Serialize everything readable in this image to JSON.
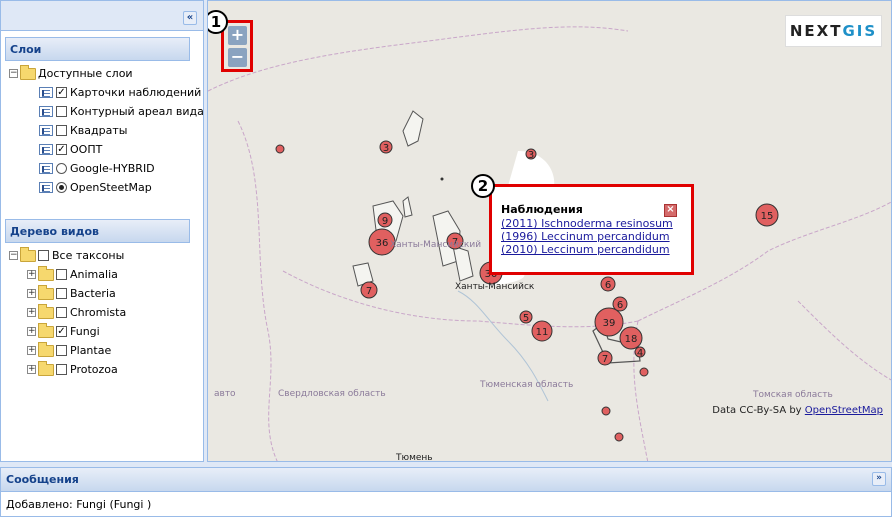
{
  "sidebar": {
    "collapse_icon": "«",
    "layers_header": "Слои",
    "layers_root": "Доступные слои",
    "layers": [
      {
        "label": "Карточки наблюдений",
        "control": "checkbox",
        "checked": true
      },
      {
        "label": "Контурный ареал вида",
        "control": "checkbox",
        "checked": false
      },
      {
        "label": "Квадраты",
        "control": "checkbox",
        "checked": false
      },
      {
        "label": "ООПТ",
        "control": "checkbox",
        "checked": true
      },
      {
        "label": "Google-HYBRID",
        "control": "radio",
        "checked": false
      },
      {
        "label": "OpenSteetMap",
        "control": "radio",
        "checked": true
      }
    ],
    "species_header": "Дерево видов",
    "species_root": "Все таксоны",
    "taxa": [
      {
        "label": "Animalia",
        "checked": false
      },
      {
        "label": "Bacteria",
        "checked": false
      },
      {
        "label": "Chromista",
        "checked": false
      },
      {
        "label": "Fungi",
        "checked": true
      },
      {
        "label": "Plantae",
        "checked": false
      },
      {
        "label": "Protozoa",
        "checked": false
      }
    ]
  },
  "map": {
    "zoom_in": "+",
    "zoom_out": "−",
    "callout_1": "1",
    "callout_2": "2",
    "logo_prefix": "NEXT",
    "logo_suffix": "GIS",
    "popup": {
      "title": "Наблюдения",
      "links": [
        "(2011) Ischnoderma resinosum",
        "(1996) Leccinum percandidum",
        "(2010) Leccinum percandidum"
      ],
      "close_icon": "close-icon"
    },
    "labels": {
      "city_khanty": "Ханты-Мансийск",
      "region_khanty": "Ханты-Мансийский",
      "region_sverdlovsk": "Свердловская область",
      "region_tyumen": "Тюменская область",
      "region_tomsk": "Томская область",
      "city_tyumen": "Тюмень",
      "other": "авто"
    },
    "clusters": [
      "3",
      "3",
      "15",
      "9",
      "36",
      "7",
      "30",
      "7",
      "6",
      "6",
      "5",
      "11",
      "39",
      "18",
      "4",
      "7"
    ],
    "attribution_prefix": "Data CC-By-SA by",
    "attribution_link": "OpenStreetMap"
  },
  "messages": {
    "header": "Сообщения",
    "toggle_icon": "»",
    "text": "Добавлено: Fungi (Fungi )"
  },
  "colors": {
    "panel_blue": "#15428b",
    "border_blue": "#99bbe8",
    "highlight_red": "#e00000",
    "cluster_fill": "#e06060"
  }
}
